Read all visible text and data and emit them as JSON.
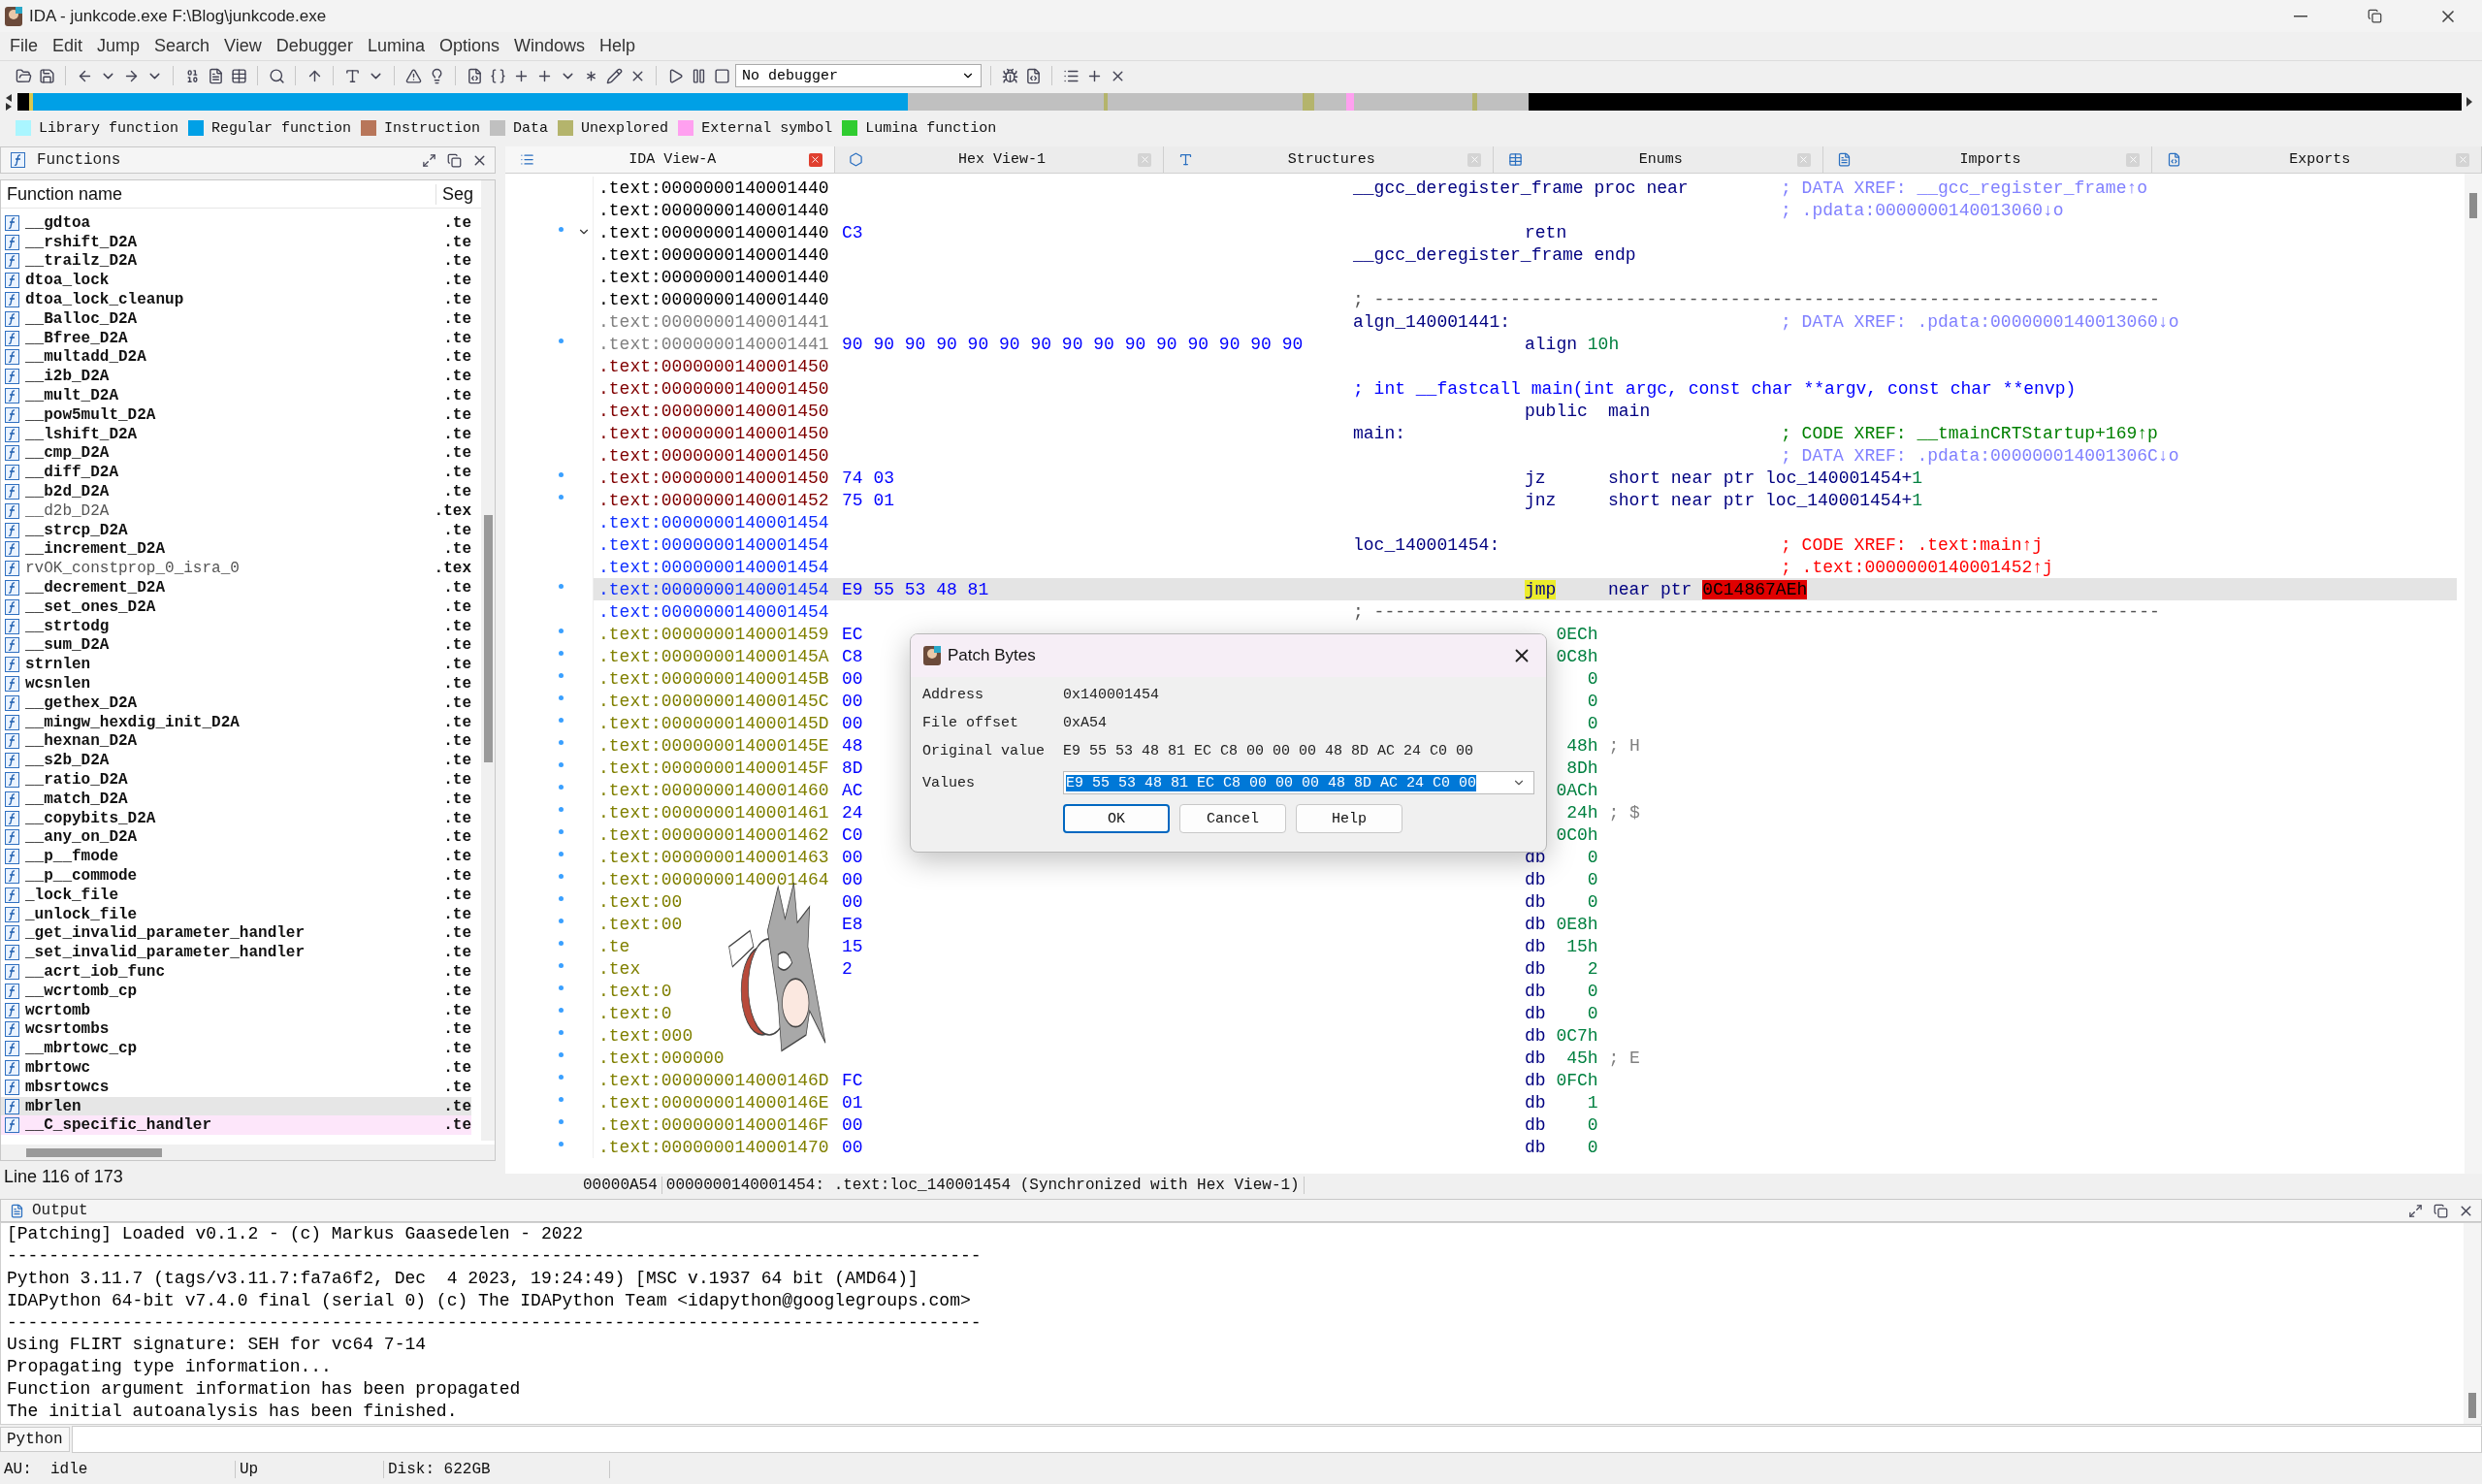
{
  "window": {
    "title": "IDA - junkcode.exe F:\\Blog\\junkcode.exe"
  },
  "menu": [
    "File",
    "Edit",
    "Jump",
    "Search",
    "View",
    "Debugger",
    "Lumina",
    "Options",
    "Windows",
    "Help"
  ],
  "toolbar": {
    "debugger": "No debugger"
  },
  "legend": [
    {
      "label": "Library function",
      "color": "#aaf6ff"
    },
    {
      "label": "Regular function",
      "color": "#00a0e6"
    },
    {
      "label": "Instruction",
      "color": "#b8765a"
    },
    {
      "label": "Data",
      "color": "#c0c0c0"
    },
    {
      "label": "Unexplored",
      "color": "#b4b46c"
    },
    {
      "label": "External symbol",
      "color": "#ffa0f0"
    },
    {
      "label": "Lumina function",
      "color": "#30cc30"
    }
  ],
  "functions": {
    "title": "Functions",
    "columns": [
      "Function name",
      "Seg"
    ],
    "items": [
      {
        "name": "__gdtoa",
        "seg": ".te",
        "kind": "regular",
        "selected": false
      },
      {
        "name": "__rshift_D2A",
        "seg": ".te",
        "kind": "regular",
        "selected": false
      },
      {
        "name": "__trailz_D2A",
        "seg": ".te",
        "kind": "regular",
        "selected": false
      },
      {
        "name": "dtoa_lock",
        "seg": ".te",
        "kind": "regular",
        "selected": false
      },
      {
        "name": "dtoa_lock_cleanup",
        "seg": ".te",
        "kind": "regular",
        "selected": false
      },
      {
        "name": "__Balloc_D2A",
        "seg": ".te",
        "kind": "regular",
        "selected": false
      },
      {
        "name": "__Bfree_D2A",
        "seg": ".te",
        "kind": "regular",
        "selected": false
      },
      {
        "name": "__multadd_D2A",
        "seg": ".te",
        "kind": "regular",
        "selected": false
      },
      {
        "name": "__i2b_D2A",
        "seg": ".te",
        "kind": "regular",
        "selected": false
      },
      {
        "name": "__mult_D2A",
        "seg": ".te",
        "kind": "regular",
        "selected": false
      },
      {
        "name": "__pow5mult_D2A",
        "seg": ".te",
        "kind": "regular",
        "selected": false
      },
      {
        "name": "__lshift_D2A",
        "seg": ".te",
        "kind": "regular",
        "selected": false
      },
      {
        "name": "__cmp_D2A",
        "seg": ".te",
        "kind": "regular",
        "selected": false
      },
      {
        "name": "__diff_D2A",
        "seg": ".te",
        "kind": "regular",
        "selected": false
      },
      {
        "name": "__b2d_D2A",
        "seg": ".te",
        "kind": "regular",
        "selected": false
      },
      {
        "name": "__d2b_D2A",
        "seg": ".tex",
        "kind": "plain",
        "selected": false
      },
      {
        "name": "__strcp_D2A",
        "seg": ".te",
        "kind": "regular",
        "selected": false
      },
      {
        "name": "__increment_D2A",
        "seg": ".te",
        "kind": "regular",
        "selected": false
      },
      {
        "name": "rvOK_constprop_0_isra_0",
        "seg": ".tex",
        "kind": "plain",
        "selected": false
      },
      {
        "name": "__decrement_D2A",
        "seg": ".te",
        "kind": "regular",
        "selected": false
      },
      {
        "name": "__set_ones_D2A",
        "seg": ".te",
        "kind": "regular",
        "selected": false
      },
      {
        "name": "__strtodg",
        "seg": ".te",
        "kind": "regular",
        "selected": false
      },
      {
        "name": "__sum_D2A",
        "seg": ".te",
        "kind": "regular",
        "selected": false
      },
      {
        "name": "strnlen",
        "seg": ".te",
        "kind": "regular",
        "selected": false
      },
      {
        "name": "wcsnlen",
        "seg": ".te",
        "kind": "regular",
        "selected": false
      },
      {
        "name": "__gethex_D2A",
        "seg": ".te",
        "kind": "regular",
        "selected": false
      },
      {
        "name": "__mingw_hexdig_init_D2A",
        "seg": ".te",
        "kind": "regular",
        "selected": false
      },
      {
        "name": "__hexnan_D2A",
        "seg": ".te",
        "kind": "regular",
        "selected": false
      },
      {
        "name": "__s2b_D2A",
        "seg": ".te",
        "kind": "regular",
        "selected": false
      },
      {
        "name": "__ratio_D2A",
        "seg": ".te",
        "kind": "regular",
        "selected": false
      },
      {
        "name": "__match_D2A",
        "seg": ".te",
        "kind": "regular",
        "selected": false
      },
      {
        "name": "__copybits_D2A",
        "seg": ".te",
        "kind": "regular",
        "selected": false
      },
      {
        "name": "__any_on_D2A",
        "seg": ".te",
        "kind": "regular",
        "selected": false
      },
      {
        "name": "__p__fmode",
        "seg": ".te",
        "kind": "regular",
        "selected": false
      },
      {
        "name": "__p__commode",
        "seg": ".te",
        "kind": "regular",
        "selected": false
      },
      {
        "name": "_lock_file",
        "seg": ".te",
        "kind": "regular",
        "selected": false
      },
      {
        "name": "_unlock_file",
        "seg": ".te",
        "kind": "regular",
        "selected": false
      },
      {
        "name": "_get_invalid_parameter_handler",
        "seg": ".te",
        "kind": "regular",
        "selected": false
      },
      {
        "name": "_set_invalid_parameter_handler",
        "seg": ".te",
        "kind": "regular",
        "selected": false
      },
      {
        "name": "__acrt_iob_func",
        "seg": ".te",
        "kind": "regular",
        "selected": false
      },
      {
        "name": "__wcrtomb_cp",
        "seg": ".te",
        "kind": "regular",
        "selected": false
      },
      {
        "name": "wcrtomb",
        "seg": ".te",
        "kind": "regular",
        "selected": false
      },
      {
        "name": "wcsrtombs",
        "seg": ".te",
        "kind": "regular",
        "selected": false
      },
      {
        "name": "__mbrtowc_cp",
        "seg": ".te",
        "kind": "regular",
        "selected": false
      },
      {
        "name": "mbrtowc",
        "seg": ".te",
        "kind": "regular",
        "selected": false
      },
      {
        "name": "mbsrtowcs",
        "seg": ".te",
        "kind": "regular",
        "selected": false
      },
      {
        "name": "mbrlen",
        "seg": ".te",
        "kind": "regular",
        "selected": true
      },
      {
        "name": "__C_specific_handler",
        "seg": ".te",
        "kind": "library",
        "selected": false
      }
    ],
    "status": "Line 116 of 173"
  },
  "tabs": [
    {
      "label": "IDA View-A",
      "selected": true
    },
    {
      "label": "Hex View-1",
      "selected": false
    },
    {
      "label": "Structures",
      "selected": false
    },
    {
      "label": "Enums",
      "selected": false
    },
    {
      "label": "Imports",
      "selected": false
    },
    {
      "label": "Exports",
      "selected": false
    }
  ],
  "disassembly": {
    "rows": [
      {
        "addr": ".text:0000000140001440",
        "color": "#000000",
        "dot": false,
        "selected": false,
        "kind": "label",
        "label": "__gcc_deregister_frame proc near",
        "comment": {
          "text": "; DATA XREF: __gcc_register_frame↑o",
          "color": "#8080ff"
        }
      },
      {
        "addr": ".text:0000000140001440",
        "color": "#000000",
        "dot": false,
        "selected": false,
        "kind": "comment",
        "comment": {
          "text": "; .pdata:0000000140013060↓o",
          "color": "#8080ff"
        }
      },
      {
        "addr": ".text:0000000140001440",
        "color": "#000000",
        "bytes": "C3",
        "dot": true,
        "expanded": true,
        "selected": false,
        "kind": "instr",
        "mnem": "retn",
        "marked": false
      },
      {
        "addr": ".text:0000000140001440",
        "color": "#000000",
        "dot": false,
        "selected": false,
        "kind": "label",
        "label": "__gcc_deregister_frame endp"
      },
      {
        "addr": ".text:0000000140001440",
        "color": "#000000",
        "dot": false,
        "selected": false,
        "kind": "blank"
      },
      {
        "addr": ".text:0000000140001440",
        "color": "#000000",
        "dot": false,
        "selected": false,
        "kind": "sep",
        "text": "; ---------------------------------------------------------------------------"
      },
      {
        "addr": ".text:0000000140001441",
        "color": "#808080",
        "dot": false,
        "selected": false,
        "kind": "label",
        "label": "algn_140001441:",
        "comment": {
          "text": "; DATA XREF: .pdata:0000000140013060↓o",
          "color": "#8080ff"
        }
      },
      {
        "addr": ".text:0000000140001441",
        "color": "#808080",
        "bytes": "90 90 90 90 90 90 90 90 90 90 90 90 90 90 90",
        "dot": true,
        "selected": false,
        "kind": "directive",
        "mnem": "align",
        "operand_num": "10h"
      },
      {
        "addr": ".text:0000000140001450",
        "color": "#800000",
        "dot": false,
        "selected": false,
        "kind": "blank"
      },
      {
        "addr": ".text:0000000140001450",
        "color": "#800000",
        "dot": false,
        "selected": false,
        "kind": "proto",
        "text": "; int __fastcall main(int argc, const char **argv, const char **envp)"
      },
      {
        "addr": ".text:0000000140001450",
        "color": "#800000",
        "dot": false,
        "selected": false,
        "kind": "instr",
        "mnem": "public",
        "operand": "main",
        "marked": false
      },
      {
        "addr": ".text:0000000140001450",
        "color": "#800000",
        "dot": false,
        "selected": false,
        "kind": "label",
        "label": "main:",
        "comment": {
          "text": "; CODE XREF: __tmainCRTStartup+169↑p",
          "color": "#008000"
        }
      },
      {
        "addr": ".text:0000000140001450",
        "color": "#800000",
        "dot": false,
        "selected": false,
        "kind": "comment",
        "comment": {
          "text": "; DATA XREF: .pdata:000000014001306C↓o",
          "color": "#8080ff"
        }
      },
      {
        "addr": ".text:0000000140001450",
        "color": "#800000",
        "bytes": "74 03",
        "dot": true,
        "selected": false,
        "kind": "instr",
        "mnem": "jz",
        "operand": "short near ptr loc_140001454+",
        "operand_num": "1",
        "marked": false
      },
      {
        "addr": ".text:0000000140001452",
        "color": "#800000",
        "bytes": "75 01",
        "dot": true,
        "selected": false,
        "kind": "instr",
        "mnem": "jnz",
        "operand": "short near ptr loc_140001454+",
        "operand_num": "1",
        "marked": false
      },
      {
        "addr": ".text:0000000140001454",
        "color": "#1030ff",
        "dot": false,
        "selected": false,
        "kind": "blank"
      },
      {
        "addr": ".text:0000000140001454",
        "color": "#1030ff",
        "dot": false,
        "selected": false,
        "kind": "label",
        "label": "loc_140001454:",
        "comment": {
          "text": "; CODE XREF: .text:main↑j",
          "color": "#ff0000"
        }
      },
      {
        "addr": ".text:0000000140001454",
        "color": "#1030ff",
        "dot": false,
        "selected": false,
        "kind": "comment",
        "comment": {
          "text": "; .text:0000000140001452↑j",
          "color": "#ff0000"
        }
      },
      {
        "addr": ".text:0000000140001454",
        "color": "#1030ff",
        "bytes": "E9 55 53 48 81",
        "dot": true,
        "selected": true,
        "kind": "instr",
        "mnem": "jmp",
        "operand": "near ptr",
        "bad_target": "0C14867AEh",
        "marked": true
      },
      {
        "addr": ".text:0000000140001454",
        "color": "#1030ff",
        "dot": false,
        "selected": false,
        "kind": "sep",
        "text": "; ---------------------------------------------------------------------------"
      },
      {
        "addr": ".text:0000000140001459",
        "color": "#808000",
        "bytes": "EC",
        "dot": true,
        "selected": false,
        "kind": "db",
        "value": "0ECh"
      },
      {
        "addr": ".text:000000014000145A",
        "color": "#808000",
        "bytes": "C8",
        "dot": true,
        "selected": false,
        "kind": "db",
        "value": "0C8h"
      },
      {
        "addr": ".text:000000014000145B",
        "color": "#808000",
        "bytes": "00",
        "dot": true,
        "selected": false,
        "kind": "db",
        "value": "0"
      },
      {
        "addr": ".text:000000014000145C",
        "color": "#808000",
        "bytes": "00",
        "dot": true,
        "selected": false,
        "kind": "db",
        "value": "0"
      },
      {
        "addr": ".text:000000014000145D",
        "color": "#808000",
        "bytes": "00",
        "dot": true,
        "selected": false,
        "kind": "db",
        "value": "0"
      },
      {
        "addr": ".text:000000014000145E",
        "color": "#808000",
        "bytes": "48",
        "dot": true,
        "selected": false,
        "kind": "db",
        "value": "48h",
        "comment": {
          "text": "; H",
          "color": "#808080"
        }
      },
      {
        "addr": ".text:000000014000145F",
        "color": "#808000",
        "bytes": "8D",
        "dot": true,
        "selected": false,
        "kind": "db",
        "value": "8Dh"
      },
      {
        "addr": ".text:0000000140001460",
        "color": "#808000",
        "bytes": "AC",
        "dot": true,
        "selected": false,
        "kind": "db",
        "value": "0ACh"
      },
      {
        "addr": ".text:0000000140001461",
        "color": "#808000",
        "bytes": "24",
        "dot": true,
        "selected": false,
        "kind": "db",
        "value": "24h",
        "comment": {
          "text": "; $",
          "color": "#808080"
        }
      },
      {
        "addr": ".text:0000000140001462",
        "color": "#808000",
        "bytes": "C0",
        "dot": true,
        "selected": false,
        "kind": "db",
        "value": "0C0h"
      },
      {
        "addr": ".text:0000000140001463",
        "color": "#808000",
        "bytes": "00",
        "dot": true,
        "selected": false,
        "kind": "db",
        "mnem": "db",
        "value": "0"
      },
      {
        "addr": ".text:0000000140001464",
        "color": "#808000",
        "bytes": "00",
        "dot": true,
        "selected": false,
        "kind": "db",
        "mnem": "db",
        "value": "0"
      },
      {
        "addr": ".text:00",
        "color": "#808000",
        "bytes": "00",
        "dot": true,
        "selected": false,
        "kind": "db",
        "mnem": "db",
        "value": "0"
      },
      {
        "addr": ".text:00",
        "color": "#808000",
        "bytes": "E8",
        "dot": true,
        "selected": false,
        "kind": "db",
        "mnem": "db",
        "value": "0E8h"
      },
      {
        "addr": ".te",
        "color": "#808000",
        "bytes": "15",
        "dot": true,
        "selected": false,
        "kind": "db",
        "mnem": "db",
        "value": "15h"
      },
      {
        "addr": ".tex",
        "color": "#808000",
        "bytes": "2",
        "dot": true,
        "selected": false,
        "kind": "db",
        "mnem": "db",
        "value": "2"
      },
      {
        "addr": ".text:0",
        "color": "#808000",
        "dot": true,
        "selected": false,
        "kind": "db",
        "mnem": "db",
        "value": "0"
      },
      {
        "addr": ".text:0",
        "color": "#808000",
        "dot": true,
        "selected": false,
        "kind": "db",
        "mnem": "db",
        "value": "0"
      },
      {
        "addr": ".text:000",
        "color": "#808000",
        "dot": true,
        "selected": false,
        "kind": "db",
        "mnem": "db",
        "value": "0C7h"
      },
      {
        "addr": ".text:000000",
        "color": "#808000",
        "dot": true,
        "selected": false,
        "kind": "db",
        "mnem": "db",
        "value": "45h",
        "comment": {
          "text": "; E",
          "color": "#808080"
        }
      },
      {
        "addr": ".text:000000014000146D",
        "color": "#808000",
        "bytes": "FC",
        "dot": true,
        "selected": false,
        "kind": "db",
        "mnem": "db",
        "value": "0FCh"
      },
      {
        "addr": ".text:000000014000146E",
        "color": "#808000",
        "bytes": "01",
        "dot": true,
        "selected": false,
        "kind": "db",
        "mnem": "db",
        "value": "1"
      },
      {
        "addr": ".text:000000014000146F",
        "color": "#808000",
        "bytes": "00",
        "dot": true,
        "selected": false,
        "kind": "db",
        "mnem": "db",
        "value": "0"
      },
      {
        "addr": ".text:0000000140001470",
        "color": "#808000",
        "bytes": "00",
        "dot": true,
        "selected": false,
        "kind": "db",
        "mnem": "db",
        "value": "0"
      }
    ],
    "status": [
      "00000A54",
      "0000000140001454: .text:loc_140001454 (Synchronized with Hex View-1)"
    ]
  },
  "dialog": {
    "title": "Patch Bytes",
    "fields": [
      {
        "label": "Address",
        "value": "0x140001454"
      },
      {
        "label": "File offset",
        "value": "0xA54"
      },
      {
        "label": "Original value",
        "value": "E9 55 53 48 81 EC C8 00 00 00 48 8D AC 24 C0 00"
      }
    ],
    "values": {
      "label": "Values",
      "value": "E9 55 53 48 81 EC C8 00 00 00 48 8D AC 24 C0 00",
      "value_selected": true
    },
    "buttons": [
      {
        "label": "OK",
        "default": true
      },
      {
        "label": "Cancel",
        "default": false
      },
      {
        "label": "Help",
        "default": false
      }
    ]
  },
  "output": {
    "title": "Output",
    "lines": [
      "[Patching] Loaded v0.1.2 - (c) Markus Gaasedelen - 2022",
      "---------------------------------------------------------------------------------------------",
      "Python 3.11.7 (tags/v3.11.7:fa7a6f2, Dec  4 2023, 19:24:49) [MSC v.1937 64 bit (AMD64)]",
      "IDAPython 64-bit v7.4.0 final (serial 0) (c) The IDAPython Team <idapython@googlegroups.com>",
      "---------------------------------------------------------------------------------------------",
      "Using FLIRT signature: SEH for vc64 7-14",
      "Propagating type information...",
      "Function argument information has been propagated",
      "The initial autoanalysis has been finished."
    ]
  },
  "python": {
    "label": "Python"
  },
  "status_bar": [
    {
      "label": "AU:",
      "value": "idle"
    },
    {
      "label": "Up"
    },
    {
      "label": "Disk: 622GB"
    }
  ]
}
